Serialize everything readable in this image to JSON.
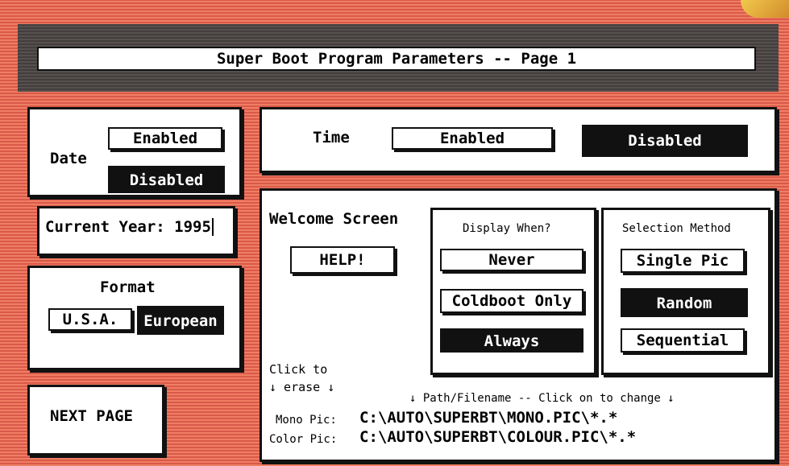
{
  "title": "Super Boot Program Parameters -- Page 1",
  "date": {
    "label": "Date",
    "enabled_label": "Enabled",
    "disabled_label": "Disabled",
    "selected": "Disabled"
  },
  "time": {
    "label": "Time",
    "enabled_label": "Enabled",
    "disabled_label": "Disabled",
    "selected": "Disabled"
  },
  "current_year": {
    "label": "Current Year:",
    "value": "1995"
  },
  "format": {
    "label": "Format",
    "usa_label": "U.S.A.",
    "european_label": "European",
    "selected": "European"
  },
  "welcome": {
    "label": "Welcome Screen",
    "help_label": "HELP!"
  },
  "display_when": {
    "label": "Display When?",
    "options": [
      "Never",
      "Coldboot Only",
      "Always"
    ],
    "selected": "Always"
  },
  "selection_method": {
    "label": "Selection Method",
    "options": [
      "Single Pic",
      "Random",
      "Sequential"
    ],
    "selected": "Random"
  },
  "erase_hint": {
    "line1": "Click  to",
    "line2": "↓ erase ↓"
  },
  "path_hint": "↓ Path/Filename -- Click on to change ↓",
  "mono_pic": {
    "label": "Mono Pic:",
    "path": "C:\\AUTO\\SUPERBT\\MONO.PIC\\*.*"
  },
  "color_pic": {
    "label": "Color Pic:",
    "path": "C:\\AUTO\\SUPERBT\\COLOUR.PIC\\*.*"
  },
  "next_page_label": "NEXT PAGE",
  "colors": {
    "background": "#e8735a",
    "panel": "#ffffff",
    "selected": "#111111",
    "title_bar": "#4c4746"
  }
}
